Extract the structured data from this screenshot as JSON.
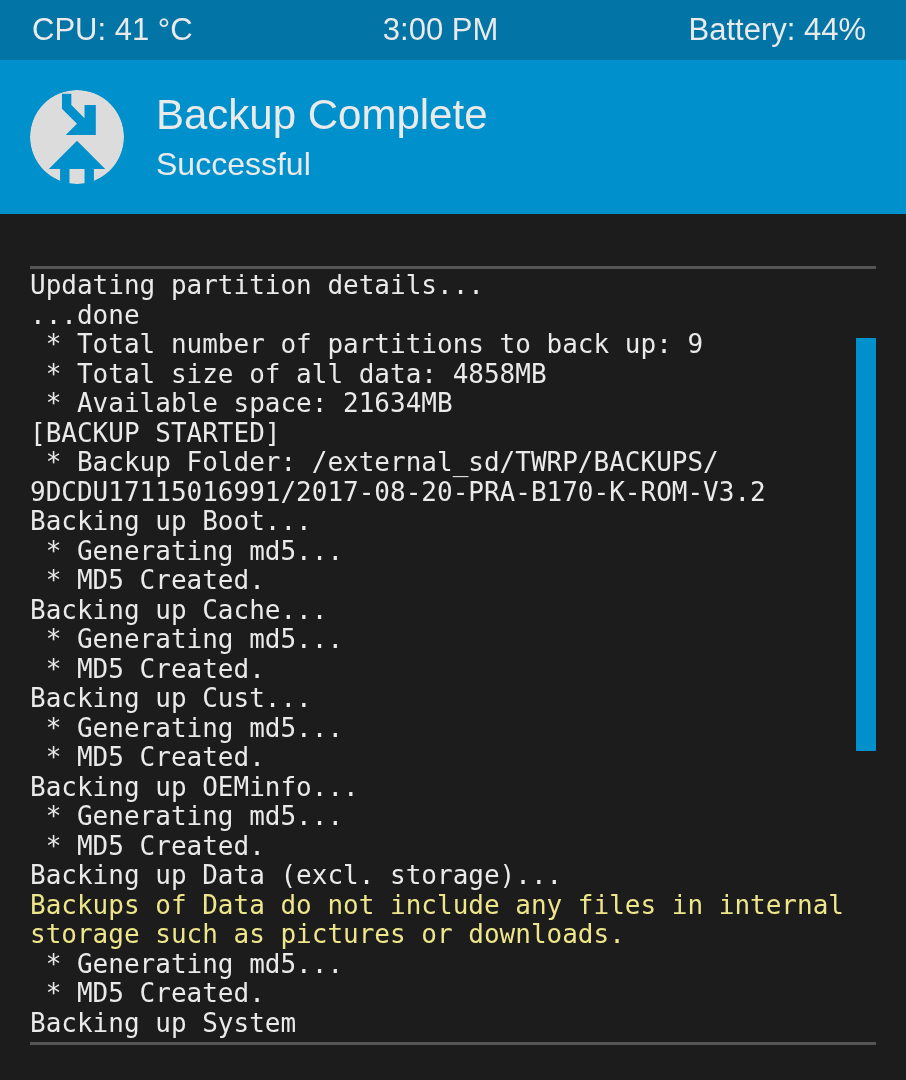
{
  "status_bar": {
    "cpu": "CPU: 41 °C",
    "time": "3:00 PM",
    "battery": "Battery: 44%"
  },
  "header": {
    "title": "Backup Complete",
    "subtitle": "Successful"
  },
  "console": {
    "lines": [
      {
        "text": "Updating partition details...",
        "kind": "normal"
      },
      {
        "text": "...done",
        "kind": "normal"
      },
      {
        "text": " * Total number of partitions to back up: 9",
        "kind": "normal"
      },
      {
        "text": " * Total size of all data: 4858MB",
        "kind": "normal"
      },
      {
        "text": " * Available space: 21634MB",
        "kind": "normal"
      },
      {
        "text": "[BACKUP STARTED]",
        "kind": "normal"
      },
      {
        "text": " * Backup Folder: /external_sd/TWRP/BACKUPS/",
        "kind": "normal"
      },
      {
        "text": "9DCDU17115016991/2017-08-20-PRA-B170-K-ROM-V3.2",
        "kind": "normal"
      },
      {
        "text": "Backing up Boot...",
        "kind": "normal"
      },
      {
        "text": " * Generating md5...",
        "kind": "normal"
      },
      {
        "text": " * MD5 Created.",
        "kind": "normal"
      },
      {
        "text": "Backing up Cache...",
        "kind": "normal"
      },
      {
        "text": " * Generating md5...",
        "kind": "normal"
      },
      {
        "text": " * MD5 Created.",
        "kind": "normal"
      },
      {
        "text": "Backing up Cust...",
        "kind": "normal"
      },
      {
        "text": " * Generating md5...",
        "kind": "normal"
      },
      {
        "text": " * MD5 Created.",
        "kind": "normal"
      },
      {
        "text": "Backing up OEMinfo...",
        "kind": "normal"
      },
      {
        "text": " * Generating md5...",
        "kind": "normal"
      },
      {
        "text": " * MD5 Created.",
        "kind": "normal"
      },
      {
        "text": "Backing up Data (excl. storage)...",
        "kind": "normal"
      },
      {
        "text": "Backups of Data do not include any files in internal",
        "kind": "warning"
      },
      {
        "text": "storage such as pictures or downloads.",
        "kind": "warning"
      },
      {
        "text": " * Generating md5...",
        "kind": "normal"
      },
      {
        "text": " * MD5 Created.",
        "kind": "normal"
      },
      {
        "text": "Backing up System",
        "kind": "normal"
      }
    ]
  }
}
